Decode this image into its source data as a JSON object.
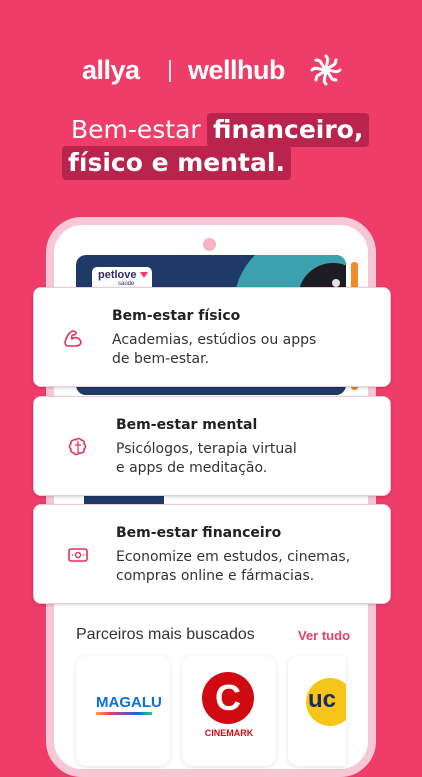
{
  "brand": {
    "partner1": "allya",
    "partner2": "wellhub"
  },
  "headline": {
    "line1_plain": "Bem-estar",
    "line1_highlight": "financeiro,",
    "line2_highlight": "físico e mental."
  },
  "banner": {
    "logo_name": "petlove",
    "logo_sub": "saúde"
  },
  "cards": [
    {
      "icon": "muscle-arm-icon",
      "title": "Bem-estar físico",
      "desc_line1": "Academias, estúdios ou apps",
      "desc_line2": "de bem-estar."
    },
    {
      "icon": "brain-icon",
      "title": "Bem-estar mental",
      "desc_line1": "Psicólogos, terapia virtual",
      "desc_line2": "e apps de meditação."
    },
    {
      "icon": "money-bill-icon",
      "title": "Bem-estar financeiro",
      "desc_line1": "Economize em estudos, cinemas,",
      "desc_line2": "compras online e fármacias."
    }
  ],
  "partners_section": {
    "title": "Parceiros mais buscados",
    "see_all": "Ver tudo",
    "partners": [
      {
        "name": "MAGALU"
      },
      {
        "name": "CINEMARK",
        "mark": "C"
      },
      {
        "name": "UCI",
        "mark": "uc"
      }
    ]
  },
  "colors": {
    "background": "#ef3d6a",
    "highlight_chip": "#b8244c",
    "accent": "#ef3d6a"
  }
}
